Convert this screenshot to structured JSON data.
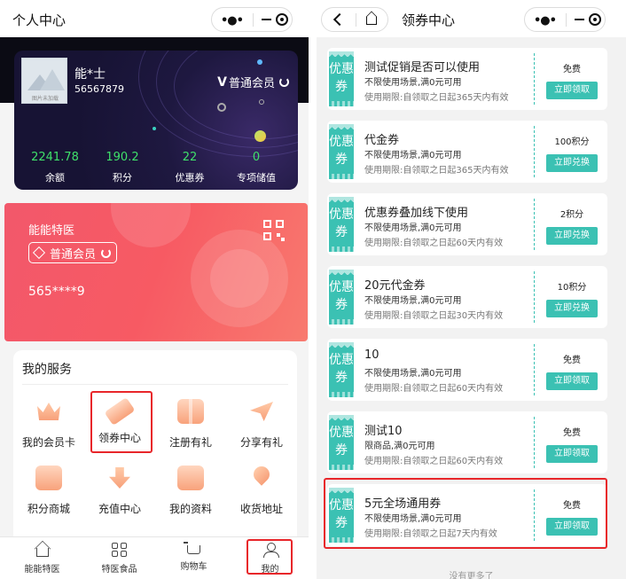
{
  "left": {
    "nav_title": "个人中心",
    "account": {
      "avatar_caption": "图片未加载",
      "name": "能*士",
      "id": "56567879",
      "level": "普通会员",
      "stats": [
        {
          "value": "2241.78",
          "label": "余额"
        },
        {
          "value": "190.2",
          "label": "积分"
        },
        {
          "value": "22",
          "label": "优惠券"
        },
        {
          "value": "0",
          "label": "专项储值"
        }
      ]
    },
    "member_card": {
      "title": "能能特医",
      "level": "普通会员",
      "code": "565****9"
    },
    "services": {
      "title": "我的服务",
      "items": [
        {
          "label": "我的会员卡",
          "icon": "crown-icon"
        },
        {
          "label": "领券中心",
          "icon": "ticket-icon"
        },
        {
          "label": "注册有礼",
          "icon": "gift-icon"
        },
        {
          "label": "分享有礼",
          "icon": "paper-plane-icon"
        },
        {
          "label": "积分商城",
          "icon": "points-mall-icon"
        },
        {
          "label": "充值中心",
          "icon": "recharge-icon"
        },
        {
          "label": "我的资料",
          "icon": "profile-icon"
        },
        {
          "label": "收货地址",
          "icon": "location-pin-icon"
        }
      ]
    },
    "tabbar": [
      {
        "label": "能能特医",
        "icon": "home-icon"
      },
      {
        "label": "特医食品",
        "icon": "grid-icon"
      },
      {
        "label": "购物车",
        "icon": "cart-icon"
      },
      {
        "label": "我的",
        "icon": "person-icon"
      }
    ]
  },
  "right": {
    "nav_title": "领券中心",
    "tag": "优惠券",
    "coupons": [
      {
        "name": "测试促销是否可以使用",
        "desc": "不限使用场景,满0元可用",
        "valid": "使用期限:自领取之日起365天内有效",
        "price": "免费",
        "action": "立即领取"
      },
      {
        "name": "代金券",
        "desc": "不限使用场景,满0元可用",
        "valid": "使用期限:自领取之日起365天内有效",
        "price": "100积分",
        "action": "立即兑换"
      },
      {
        "name": "优惠券叠加线下使用",
        "desc": "不限使用场景,满0元可用",
        "valid": "使用期限:自领取之日起60天内有效",
        "price": "2积分",
        "action": "立即兑换"
      },
      {
        "name": "20元代金券",
        "desc": "不限使用场景,满0元可用",
        "valid": "使用期限:自领取之日起30天内有效",
        "price": "10积分",
        "action": "立即兑换"
      },
      {
        "name": "10",
        "desc": "不限使用场景,满0元可用",
        "valid": "使用期限:自领取之日起60天内有效",
        "price": "免费",
        "action": "立即领取"
      },
      {
        "name": "测试10",
        "desc": "限商品,满0元可用",
        "valid": "使用期限:自领取之日起60天内有效",
        "price": "免费",
        "action": "立即领取"
      },
      {
        "name": "5元全场通用券",
        "desc": "不限使用场景,满0元可用",
        "valid": "使用期限:自领取之日起7天内有效",
        "price": "免费",
        "action": "立即领取"
      }
    ],
    "no_more": "没有更多了"
  },
  "colors": {
    "accent": "#3bc1b3",
    "highlight": "#e8262a",
    "stat": "#3fe06a",
    "member_card": "#f75a63"
  }
}
